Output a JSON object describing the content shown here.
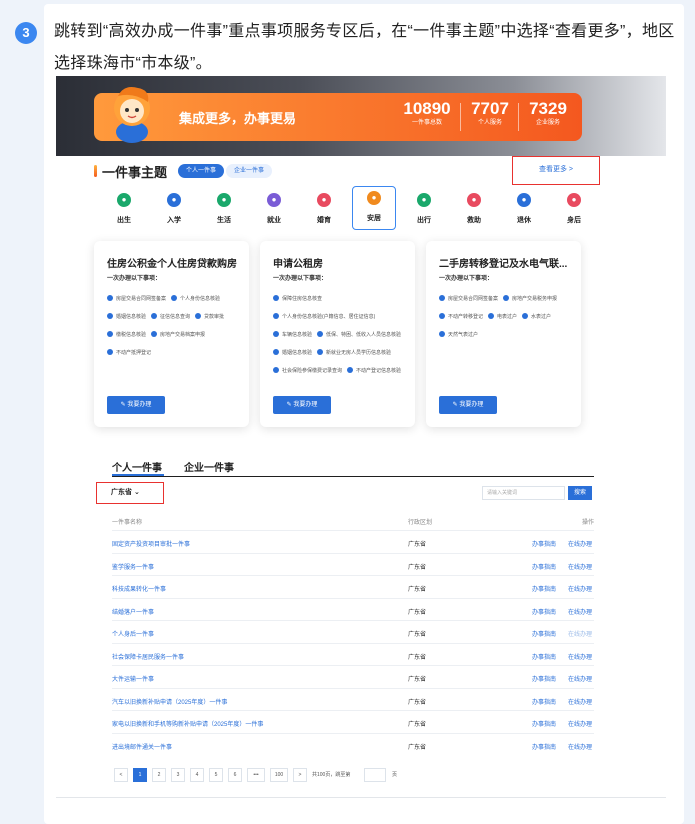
{
  "step": {
    "number": "3",
    "text": "跳转到“高效办成一件事”重点事项服务专区后，在“一件事主题”中选择“查看更多”，地区选择珠海市“市本级”。"
  },
  "banner": {
    "slogan": "集成更多，办事更易",
    "stats": [
      {
        "value": "10890",
        "label": "一件事总数"
      },
      {
        "value": "7707",
        "label": "个人服务"
      },
      {
        "value": "7329",
        "label": "企业服务"
      }
    ]
  },
  "section": {
    "title": "一件事主题",
    "tab_personal": "个人一件事",
    "tab_company": "企业一件事",
    "view_more": "查看更多 >"
  },
  "topics": [
    {
      "label": "出生",
      "color": "#1aa86b",
      "icon": "baby-icon"
    },
    {
      "label": "入学",
      "color": "#2a6fd8",
      "icon": "school-icon"
    },
    {
      "label": "生活",
      "color": "#1aa86b",
      "icon": "life-icon"
    },
    {
      "label": "就业",
      "color": "#7a5cd6",
      "icon": "job-icon"
    },
    {
      "label": "婚育",
      "color": "#e84a5f",
      "icon": "heart-icon"
    },
    {
      "label": "安居",
      "color": "#f08a1e",
      "icon": "home-icon"
    },
    {
      "label": "出行",
      "color": "#1aa86b",
      "icon": "travel-icon"
    },
    {
      "label": "救助",
      "color": "#e84a5f",
      "icon": "aid-icon"
    },
    {
      "label": "退休",
      "color": "#2a6fd8",
      "icon": "retire-icon"
    },
    {
      "label": "身后",
      "color": "#e84a5f",
      "icon": "after-icon"
    }
  ],
  "services": [
    {
      "title": "住房公积金个人住房贷款购房",
      "subtitle": "一次办理以下事项：",
      "items": [
        "房屋交易合同网签备案",
        "个人身份信息核验",
        "婚姻信息核验",
        "征信信息查询",
        "贷款审批",
        "缴税信息核验",
        "房地产交易档案申报",
        "不动产抵押登记"
      ],
      "button": "✎ 我要办理"
    },
    {
      "title": "申请公租房",
      "subtitle": "一次办理以下事项：",
      "items": [
        "保障住房信息核查",
        "个人身份信息核验(户籍信息、居住证信息)",
        "车辆信息核验",
        "低保、特困、低收入人员信息核验",
        "婚姻信息核验",
        "新就业无房人员学历信息核验",
        "社会保险参保缴费记录查询",
        "不动产登记信息核验"
      ],
      "button": "✎ 我要办理"
    },
    {
      "title": "二手房转移登记及水电气联...",
      "subtitle": "一次办理以下事项：",
      "items": [
        "房屋交易合同网签备案",
        "房地产交易税务申报",
        "不动产转移登记",
        "电表过户",
        "水表过户",
        "天然气表过户"
      ],
      "button": "✎ 我要办理"
    }
  ],
  "tabs2": {
    "personal": "个人一件事",
    "company": "企业一件事"
  },
  "filter": {
    "region": "广东省  ⌄",
    "search_placeholder": "请输入关键词",
    "search_button": "搜索"
  },
  "table": {
    "headers": [
      "一件事名称",
      "行政区划",
      "操作"
    ],
    "rows": [
      {
        "name": "固定资产投资项目审批一件事",
        "region": "广东省",
        "guide": "办事指南",
        "online": "在线办理"
      },
      {
        "name": "鉴学服务一件事",
        "region": "广东省",
        "guide": "办事指南",
        "online": "在线办理"
      },
      {
        "name": "科技成果转化一件事",
        "region": "广东省",
        "guide": "办事指南",
        "online": "在线办理"
      },
      {
        "name": "结婚落户一件事",
        "region": "广东省",
        "guide": "办事指南",
        "online": "在线办理"
      },
      {
        "name": "个人身后一件事",
        "region": "广东省",
        "guide": "办事指南",
        "online": "在线办理"
      },
      {
        "name": "社会保障卡居民服务一件事",
        "region": "广东省",
        "guide": "办事指南",
        "online": "在线办理"
      },
      {
        "name": "大件运输一件事",
        "region": "广东省",
        "guide": "办事指南",
        "online": "在线办理"
      },
      {
        "name": "汽车以旧换新补贴申请（2025年度）一件事",
        "region": "广东省",
        "guide": "办事指南",
        "online": "在线办理"
      },
      {
        "name": "家电以旧换新和手机等购新补贴申请（2025年度）一件事",
        "region": "广东省",
        "guide": "办事指南",
        "online": "在线办理"
      },
      {
        "name": "进出境邮件通关一件事",
        "region": "广东省",
        "guide": "办事指南",
        "online": "在线办理"
      }
    ]
  },
  "pager": {
    "prev": "<",
    "pages": [
      "1",
      "2",
      "3",
      "4",
      "5",
      "6",
      "•••",
      "100"
    ],
    "next": ">",
    "total": "共100页，跳至第",
    "unit": "页"
  }
}
